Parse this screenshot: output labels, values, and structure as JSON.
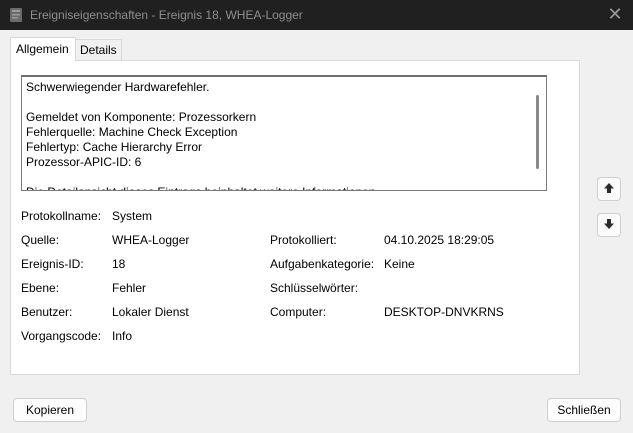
{
  "window": {
    "title": "Ereigniseigenschaften - Ereignis 18, WHEA-Logger",
    "close_glyph": "✕"
  },
  "tabs": [
    {
      "label": "Allgemein",
      "active": true
    },
    {
      "label": "Details",
      "active": false
    }
  ],
  "description": {
    "lines": [
      "Schwerwiegender Hardwarefehler.",
      "",
      "Gemeldet von Komponente: Prozessorkern",
      "Fehlerquelle: Machine Check Exception",
      "Fehlertyp: Cache Hierarchy Error",
      "Prozessor-APIC-ID: 6",
      "",
      "Die Detailansicht dieses Eintrags beinhaltet weitere Informationen."
    ]
  },
  "fields": {
    "protokollname": {
      "label": "Protokollname:",
      "value": "System"
    },
    "quelle": {
      "label": "Quelle:",
      "value": "WHEA-Logger"
    },
    "protokolliert": {
      "label": "Protokolliert:",
      "value": "04.10.2025 18:29:05"
    },
    "ereignis_id": {
      "label": "Ereignis-ID:",
      "value": "18"
    },
    "aufgabenkategorie": {
      "label": "Aufgabenkategorie:",
      "value": "Keine"
    },
    "ebene": {
      "label": "Ebene:",
      "value": "Fehler"
    },
    "schluesselwoerter": {
      "label": "Schlüsselwörter:",
      "value": ""
    },
    "benutzer": {
      "label": "Benutzer:",
      "value": "Lokaler Dienst"
    },
    "computer": {
      "label": "Computer:",
      "value": "DESKTOP-DNVKRNS"
    },
    "vorgangscode": {
      "label": "Vorgangscode:",
      "value": "Info"
    }
  },
  "buttons": {
    "copy": "Kopieren",
    "close": "Schließen"
  },
  "icons": {
    "title": "event-viewer-icon",
    "up": "arrow-up-icon",
    "down": "arrow-down-icon"
  }
}
